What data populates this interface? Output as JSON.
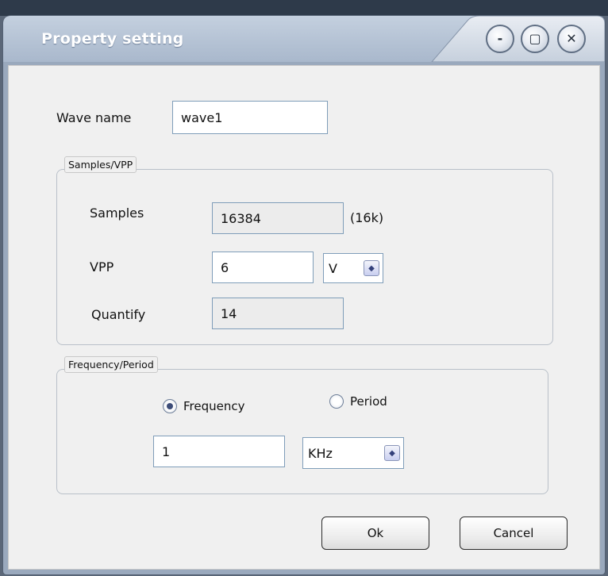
{
  "window": {
    "title": "Property setting",
    "controls": {
      "minimize": "-",
      "maximize": "▢",
      "close": "✕"
    }
  },
  "wave_name": {
    "label": "Wave name",
    "value": "wave1"
  },
  "samples_group": {
    "legend": "Samples/VPP",
    "samples_label": "Samples",
    "samples_value": "16384",
    "samples_suffix": "(16k)",
    "vpp_label": "VPP",
    "vpp_value": "6",
    "vpp_unit": "V",
    "quantify_label": "Quantify",
    "quantify_value": "14"
  },
  "freq_group": {
    "legend": "Frequency/Period",
    "frequency_label": "Frequency",
    "period_label": "Period",
    "selected": "frequency",
    "value": "1",
    "unit": "KHz"
  },
  "buttons": {
    "ok": "Ok",
    "cancel": "Cancel"
  },
  "colors": {
    "titlebar": "#b8c6d9",
    "title_text": "#ffffff",
    "client": "#f0f0f0"
  }
}
